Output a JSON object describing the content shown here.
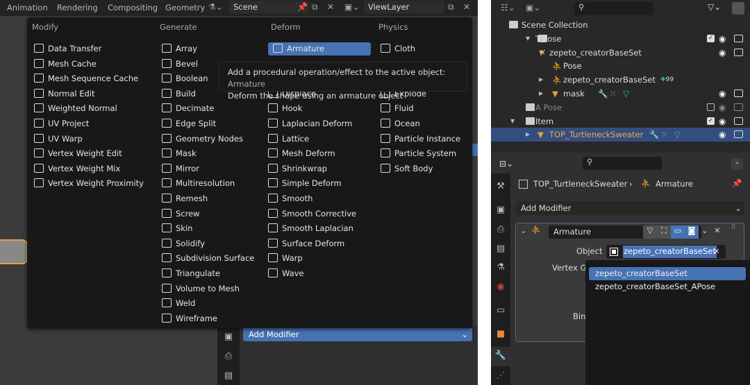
{
  "left_window": {
    "workspace_tabs": [
      "Animation",
      "Rendering",
      "Compositing",
      "Geometry"
    ],
    "scene": "Scene",
    "view_layer": "ViewLayer",
    "menu": {
      "columns": [
        {
          "header": "Modify",
          "items": [
            "Data Transfer",
            "Mesh Cache",
            "Mesh Sequence Cache",
            "Normal Edit",
            "Weighted Normal",
            "UV Project",
            "UV Warp",
            "Vertex Weight Edit",
            "Vertex Weight Mix",
            "Vertex Weight Proximity"
          ]
        },
        {
          "header": "Generate",
          "items": [
            "Array",
            "Bevel",
            "Boolean",
            "Build",
            "Decimate",
            "Edge Split",
            "Geometry Nodes",
            "Mask",
            "Mirror",
            "Multiresolution",
            "Remesh",
            "Screw",
            "Skin",
            "Solidify",
            "Subdivision Surface",
            "Triangulate",
            "Volume to Mesh",
            "Weld",
            "Wireframe"
          ]
        },
        {
          "header": "Deform",
          "items": [
            "Armature",
            "",
            "",
            "Displace",
            "Hook",
            "Laplacian Deform",
            "Lattice",
            "Mesh Deform",
            "Shrinkwrap",
            "Simple Deform",
            "Smooth",
            "Smooth Corrective",
            "Smooth Laplacian",
            "Surface Deform",
            "Warp",
            "Wave"
          ]
        },
        {
          "header": "Physics",
          "items": [
            "Cloth",
            "",
            "",
            "Explode",
            "Fluid",
            "Ocean",
            "Particle Instance",
            "Particle System",
            "Soft Body"
          ]
        }
      ],
      "selected": "Armature"
    },
    "tooltip": {
      "line1": "Add a procedural operation/effect to the active object:",
      "line1_name": "Armature",
      "line2": "Deform the shape using an armature object"
    },
    "add_modifier": "Add Modifier"
  },
  "outliner": {
    "rows": [
      {
        "label": "Scene Collection"
      },
      {
        "label": "T Pose"
      },
      {
        "label": "zepeto_creatorBaseSet"
      },
      {
        "label": "Pose"
      },
      {
        "label": "zepeto_creatorBaseSet",
        "badge": "99"
      },
      {
        "label": "mask"
      },
      {
        "label": "A Pose"
      },
      {
        "label": "Item"
      },
      {
        "label": "TOP_TurtleneckSweater"
      }
    ]
  },
  "properties": {
    "breadcrumb": {
      "object": "TOP_TurtleneckSweater",
      "modifier": "Armature"
    },
    "add_modifier": "Add Modifier",
    "modifier_name": "Armature",
    "object_label": "Object",
    "object_value": "zepeto_creatorBaseSet",
    "vertex_group_label": "Vertex Gr",
    "bind_label": "Bin",
    "dropdown_options": [
      "zepeto_creatorBaseSet",
      "zepeto_creatorBaseSet_APose"
    ],
    "dropdown_selected": "zepeto_creatorBaseSet"
  },
  "colors": {
    "accent": "#4772b3",
    "object_orange": "#e8a040",
    "armature_green": "#3cbf8a"
  }
}
